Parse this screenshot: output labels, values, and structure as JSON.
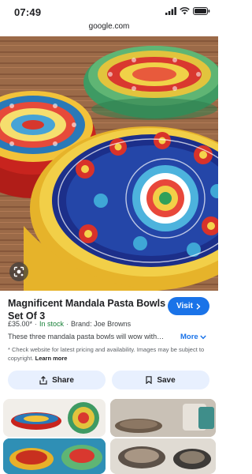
{
  "status_bar": {
    "time": "07:49"
  },
  "browser": {
    "url": "google.com"
  },
  "product": {
    "title": "Magnificent Mandala Pasta Bowls Set Of 3",
    "visit_label": "Visit",
    "price": "£35.00*",
    "stock": "In stock",
    "brand": "Brand: Joe Browns",
    "description": "These three mandala pasta bowls will wow with…",
    "more_label": "More",
    "disclaimer": "* Check website for latest pricing and availability. Images may be subject to copyright.",
    "learn_more": "Learn more"
  },
  "actions": {
    "share_label": "Share",
    "save_label": "Save"
  },
  "icons": [
    "signal-icon",
    "wifi-icon",
    "battery-icon",
    "lens-icon",
    "chevron-right-icon",
    "chevron-down-icon",
    "share-icon",
    "bookmark-icon"
  ],
  "colors": {
    "accent": "#1a73e8",
    "chip_bg": "#e8f0fe",
    "in_stock": "#188038"
  }
}
